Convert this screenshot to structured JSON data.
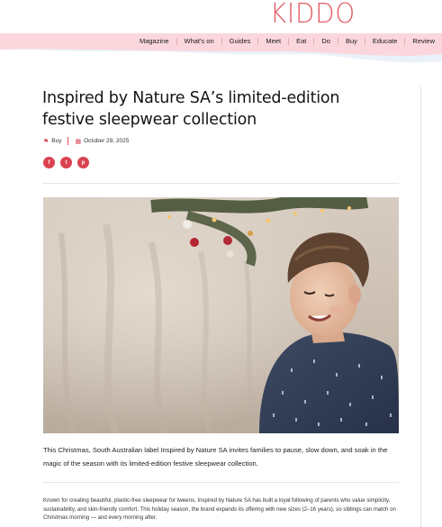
{
  "site": {
    "logo": "KIDDO"
  },
  "nav": [
    "Magazine",
    "What's on",
    "Guides",
    "Meet",
    "Eat",
    "Do",
    "Buy",
    "Educate",
    "Review"
  ],
  "article": {
    "title": "Inspired by Nature SA’s limited-edition festive sleepwear collection",
    "category": "Buy",
    "date": "October 29, 2025",
    "share": [
      "facebook-icon",
      "twitter-icon",
      "pinterest-icon"
    ],
    "intro": "This Christmas, South Australian label Inspired by Nature SA invites families to pause, slow down, and soak in the magic of the season with its limited-edition festive sleepwear collection.",
    "body": "Known for creating beautiful, plastic-free sleepwear for tweens, Inspired by Nature SA has built a loyal following of parents who value simplicity, sustainability, and skin-friendly comfort. This holiday season, the brand expands its offering with new sizes (2–16 years), so siblings can match on Christmas morning — and every morning after."
  },
  "colors": {
    "accent": "#d9434f",
    "nav_bg": "#fbd7dd",
    "logo": "#e05a63"
  }
}
